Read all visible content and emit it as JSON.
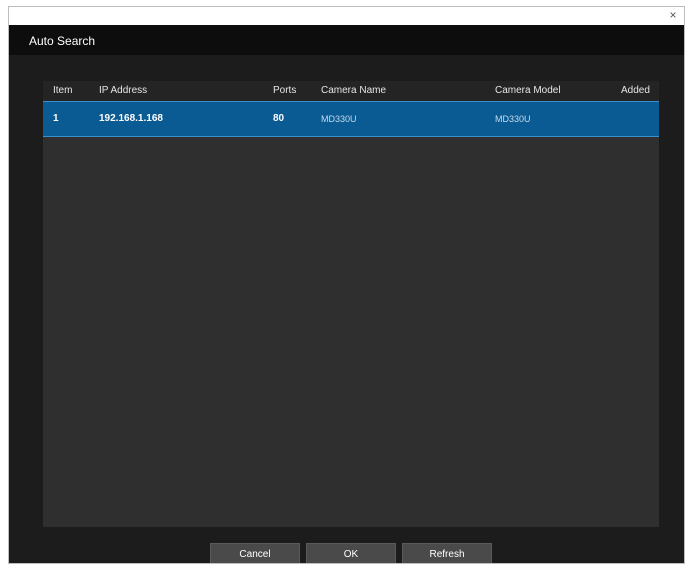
{
  "window": {
    "close_symbol": "×"
  },
  "dialog": {
    "title": "Auto Search"
  },
  "table": {
    "columns": {
      "item": "Item",
      "ip": "IP Address",
      "ports": "Ports",
      "camera_name": "Camera Name",
      "camera_model": "Camera Model",
      "added": "Added"
    },
    "rows": [
      {
        "item": "1",
        "ip": "192.168.1.168",
        "ports": "80",
        "camera_name": "MD330U",
        "camera_model": "MD330U",
        "added": ""
      }
    ]
  },
  "buttons": {
    "cancel": "Cancel",
    "ok": "OK",
    "refresh": "Refresh"
  },
  "colors": {
    "dialog_bg": "#1c1c1c",
    "header_bg": "#0d0d0d",
    "table_bg": "#2f2f2f",
    "selected_row": "#0a5a93",
    "button_bg": "#4a4a4a"
  },
  "icons": {
    "close": "close-icon"
  }
}
